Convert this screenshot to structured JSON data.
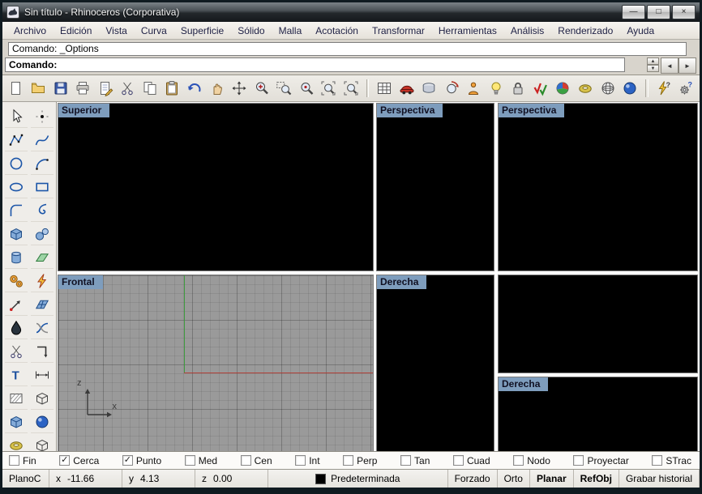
{
  "window": {
    "title": "Sin título - Rhinoceros (Corporativa)",
    "minimize_glyph": "—",
    "maximize_glyph": "□",
    "close_glyph": "×"
  },
  "menu": {
    "items": [
      "Archivo",
      "Edición",
      "Vista",
      "Curva",
      "Superficie",
      "Sólido",
      "Malla",
      "Acotación",
      "Transformar",
      "Herramientas",
      "Análisis",
      "Renderizado",
      "Ayuda"
    ]
  },
  "command": {
    "history": "Comando: _Options",
    "prompt": "Comando:",
    "scroll_up_glyph": "▲",
    "scroll_down_glyph": "▼",
    "scroll_left_glyph": "◄",
    "scroll_right_glyph": "►"
  },
  "toolbar": {
    "icons": [
      {
        "name": "new-file-icon",
        "glyph": "page"
      },
      {
        "name": "open-file-icon",
        "glyph": "folder"
      },
      {
        "name": "save-icon",
        "glyph": "floppy"
      },
      {
        "name": "print-icon",
        "glyph": "printer"
      },
      {
        "name": "notes-icon",
        "glyph": "notepage"
      },
      {
        "name": "cut-icon",
        "glyph": "scissors"
      },
      {
        "name": "copy-icon",
        "glyph": "copy"
      },
      {
        "name": "paste-icon",
        "glyph": "clipboard"
      },
      {
        "name": "undo-icon",
        "glyph": "undo"
      },
      {
        "name": "pan-icon",
        "glyph": "hand"
      },
      {
        "name": "move-view-icon",
        "glyph": "move4"
      },
      {
        "name": "zoom-dynamic-icon",
        "glyph": "zoomplus"
      },
      {
        "name": "zoom-window-icon",
        "glyph": "zoomwin"
      },
      {
        "name": "zoom-selected-icon",
        "glyph": "zoomsel"
      },
      {
        "name": "zoom-extents-icon",
        "glyph": "zoomext"
      },
      {
        "name": "zoom-extents-all-icon",
        "glyph": "zoomext"
      },
      {
        "sep": true
      },
      {
        "name": "viewport-layout-icon",
        "glyph": "gridtable"
      },
      {
        "name": "named-views-icon",
        "glyph": "car"
      },
      {
        "name": "layers-icon",
        "glyph": "layers"
      },
      {
        "name": "rotate-view-icon",
        "glyph": "rotview"
      },
      {
        "name": "set-view-icon",
        "glyph": "person"
      },
      {
        "name": "lights-icon",
        "glyph": "bulb"
      },
      {
        "name": "lock-icon",
        "glyph": "lock"
      },
      {
        "name": "show-hide-icon",
        "glyph": "checks"
      },
      {
        "name": "render-icon",
        "glyph": "ballmulti"
      },
      {
        "name": "render-preview-icon",
        "glyph": "torus"
      },
      {
        "name": "wireframe-icon",
        "glyph": "wireglobe"
      },
      {
        "name": "shaded-view-icon",
        "glyph": "bluesphere"
      },
      {
        "sep": true
      },
      {
        "name": "help-bolt-icon",
        "glyph": "boltq"
      },
      {
        "name": "options-icon",
        "glyph": "gearq"
      }
    ]
  },
  "sidebar": {
    "icons": [
      {
        "name": "select-arrow-icon",
        "glyph": "selectarrow"
      },
      {
        "name": "point-icon",
        "glyph": "point"
      },
      {
        "name": "polyline-icon",
        "glyph": "polyline"
      },
      {
        "name": "curve-icon",
        "glyph": "curve"
      },
      {
        "name": "circle-icon",
        "glyph": "circle"
      },
      {
        "name": "arc-icon",
        "glyph": "arc"
      },
      {
        "name": "ellipse-icon",
        "glyph": "ellipse"
      },
      {
        "name": "rectangle-icon",
        "glyph": "rect"
      },
      {
        "name": "fillet-icon",
        "glyph": "fillet"
      },
      {
        "name": "extend-icon",
        "glyph": "hookext"
      },
      {
        "name": "box-icon",
        "glyph": "box"
      },
      {
        "name": "sphere-icon",
        "glyph": "spheres"
      },
      {
        "name": "cylinder-icon",
        "glyph": "cylinder"
      },
      {
        "name": "plane-icon",
        "glyph": "plane"
      },
      {
        "name": "gears-icon",
        "glyph": "gears"
      },
      {
        "name": "explode-icon",
        "glyph": "bolt"
      },
      {
        "name": "move-point-icon",
        "glyph": "movepoint"
      },
      {
        "name": "surface-icon",
        "glyph": "surface"
      },
      {
        "name": "analyze-drop-icon",
        "glyph": "drop"
      },
      {
        "name": "join-icon",
        "glyph": "join"
      },
      {
        "name": "trim-icon",
        "glyph": "scissors"
      },
      {
        "name": "corner-icon",
        "glyph": "corner"
      },
      {
        "name": "text-icon",
        "glyph": "textT"
      },
      {
        "name": "dimension-icon",
        "glyph": "dimension"
      },
      {
        "name": "hatch-icon",
        "glyph": "hatch"
      },
      {
        "name": "block-icon",
        "glyph": "cubeoutline"
      },
      {
        "name": "solid-box-icon",
        "glyph": "box"
      },
      {
        "name": "solid-sphere-icon",
        "glyph": "bluesphere"
      },
      {
        "name": "torus-icon",
        "glyph": "torus"
      },
      {
        "name": "cube-icon",
        "glyph": "cubeoutline"
      }
    ]
  },
  "viewports": {
    "superior": {
      "label": "Superior"
    },
    "persp_mid": {
      "label": "Perspectiva"
    },
    "persp_right": {
      "label": "Perspectiva"
    },
    "frontal": {
      "label": "Frontal",
      "axis_vertical": "z",
      "axis_horizontal": "x"
    },
    "derecha_mid": {
      "label": "Derecha"
    },
    "derecha_bottom": {
      "label": "Derecha"
    }
  },
  "osnap": {
    "items": [
      {
        "label": "Fin",
        "checked": false
      },
      {
        "label": "Cerca",
        "checked": true
      },
      {
        "label": "Punto",
        "checked": true
      },
      {
        "label": "Med",
        "checked": false
      },
      {
        "label": "Cen",
        "checked": false
      },
      {
        "label": "Int",
        "checked": false
      },
      {
        "label": "Perp",
        "checked": false
      },
      {
        "label": "Tan",
        "checked": false
      },
      {
        "label": "Cuad",
        "checked": false
      },
      {
        "label": "Nodo",
        "checked": false
      },
      {
        "label": "Proyectar",
        "checked": false
      },
      {
        "label": "STrac",
        "checked": false
      }
    ]
  },
  "statusbar": {
    "cplane": "PlanoC",
    "coords": {
      "x_label": "x",
      "x_value": "-11.66",
      "y_label": "y",
      "y_value": "4.13",
      "z_label": "z",
      "z_value": "0.00"
    },
    "layer": {
      "name": "Predeterminada",
      "swatch": "#000000"
    },
    "toggles": [
      {
        "label": "Forzado",
        "active": false
      },
      {
        "label": "Orto",
        "active": false
      },
      {
        "label": "Planar",
        "active": true
      },
      {
        "label": "RefObj",
        "active": true
      },
      {
        "label": "Grabar historial",
        "active": false
      }
    ]
  },
  "colors": {
    "viewport_label_bg": "#7e9dbd",
    "axis_green": "#3f9b3f",
    "axis_red": "#b04038",
    "frontal_bg": "#9a9a9a"
  }
}
